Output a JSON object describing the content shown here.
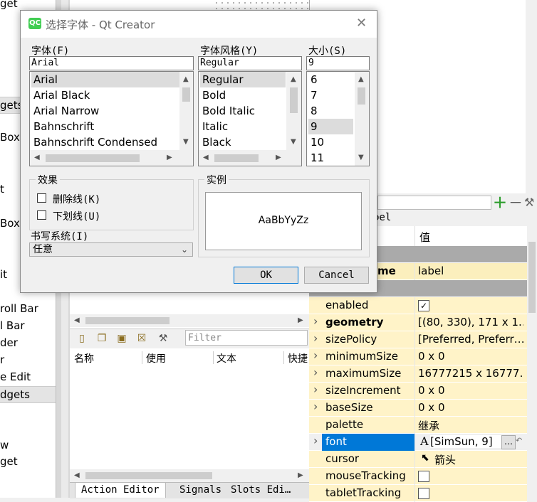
{
  "dialog": {
    "title": "选择字体 - Qt Creator",
    "logo": "QC",
    "close_icon": "close-icon",
    "font_label": "字体(F)",
    "font_value": "Arial",
    "fonts": [
      "Arial",
      "Arial Black",
      "Arial Narrow",
      "Bahnschrift",
      "Bahnschrift Condensed"
    ],
    "style_label": "字体风格(Y)",
    "style_value": "Regular",
    "styles": [
      "Regular",
      "Bold",
      "Bold Italic",
      "Italic",
      "Black"
    ],
    "size_label": "大小(S)",
    "size_value": "9",
    "sizes": [
      "6",
      "7",
      "8",
      "9",
      "10",
      "11"
    ],
    "effects_title": "效果",
    "strikeout": "删除线(K)",
    "underline": "下划线(U)",
    "sample_title": "实例",
    "sample_text": "AaBbYyZz",
    "writing_system_label": "书写系统(I)",
    "writing_system_value": "任意",
    "ok": "OK",
    "cancel": "Cancel"
  },
  "left_widgets": [
    "get",
    "gets",
    "Box",
    "t",
    "Box",
    "it",
    "roll Bar",
    "l Bar",
    "der",
    "r",
    "e Edit",
    "dgets",
    "w",
    "get"
  ],
  "action_editor": {
    "filter_placeholder": "Filter",
    "columns": [
      "名称",
      "使用",
      "文本",
      "快捷"
    ],
    "tabs": [
      "Action Editor",
      "Signals",
      "Slots Edi…"
    ]
  },
  "property_editor": {
    "object_fragment": "bel",
    "header_value": "值",
    "object_name_fragment": "me",
    "object_name_value": "label",
    "rows": [
      {
        "name": "enabled",
        "value": "",
        "check": "✓",
        "bold": false,
        "expand": false
      },
      {
        "name": "geometry",
        "value": "[(80, 330), 171 x 1…",
        "bold": true,
        "expand": true
      },
      {
        "name": "sizePolicy",
        "value": "[Preferred, Preferr…",
        "bold": false,
        "expand": true
      },
      {
        "name": "minimumSize",
        "value": "0 x 0",
        "bold": false,
        "expand": true
      },
      {
        "name": "maximumSize",
        "value": "16777215 x 16777…",
        "bold": false,
        "expand": true
      },
      {
        "name": "sizeIncrement",
        "value": "0 x 0",
        "bold": false,
        "expand": true
      },
      {
        "name": "baseSize",
        "value": "0 x 0",
        "bold": false,
        "expand": true
      },
      {
        "name": "palette",
        "value": "继承",
        "bold": false,
        "expand": false
      },
      {
        "name": "font",
        "value": "[SimSun, 9]",
        "bold": false,
        "expand": true
      },
      {
        "name": "cursor",
        "value": "箭头",
        "bold": false,
        "expand": false
      },
      {
        "name": "mouseTracking",
        "value": "",
        "check": "",
        "bold": false,
        "expand": false
      },
      {
        "name": "tabletTracking",
        "value": "",
        "check": "",
        "bold": false,
        "expand": false
      }
    ],
    "font_btn": "…",
    "colors": {
      "selected": "#0078d7",
      "row_yellow": "#fff3c8",
      "group": "#aaaaaa",
      "add": "#2e9e2e"
    }
  }
}
